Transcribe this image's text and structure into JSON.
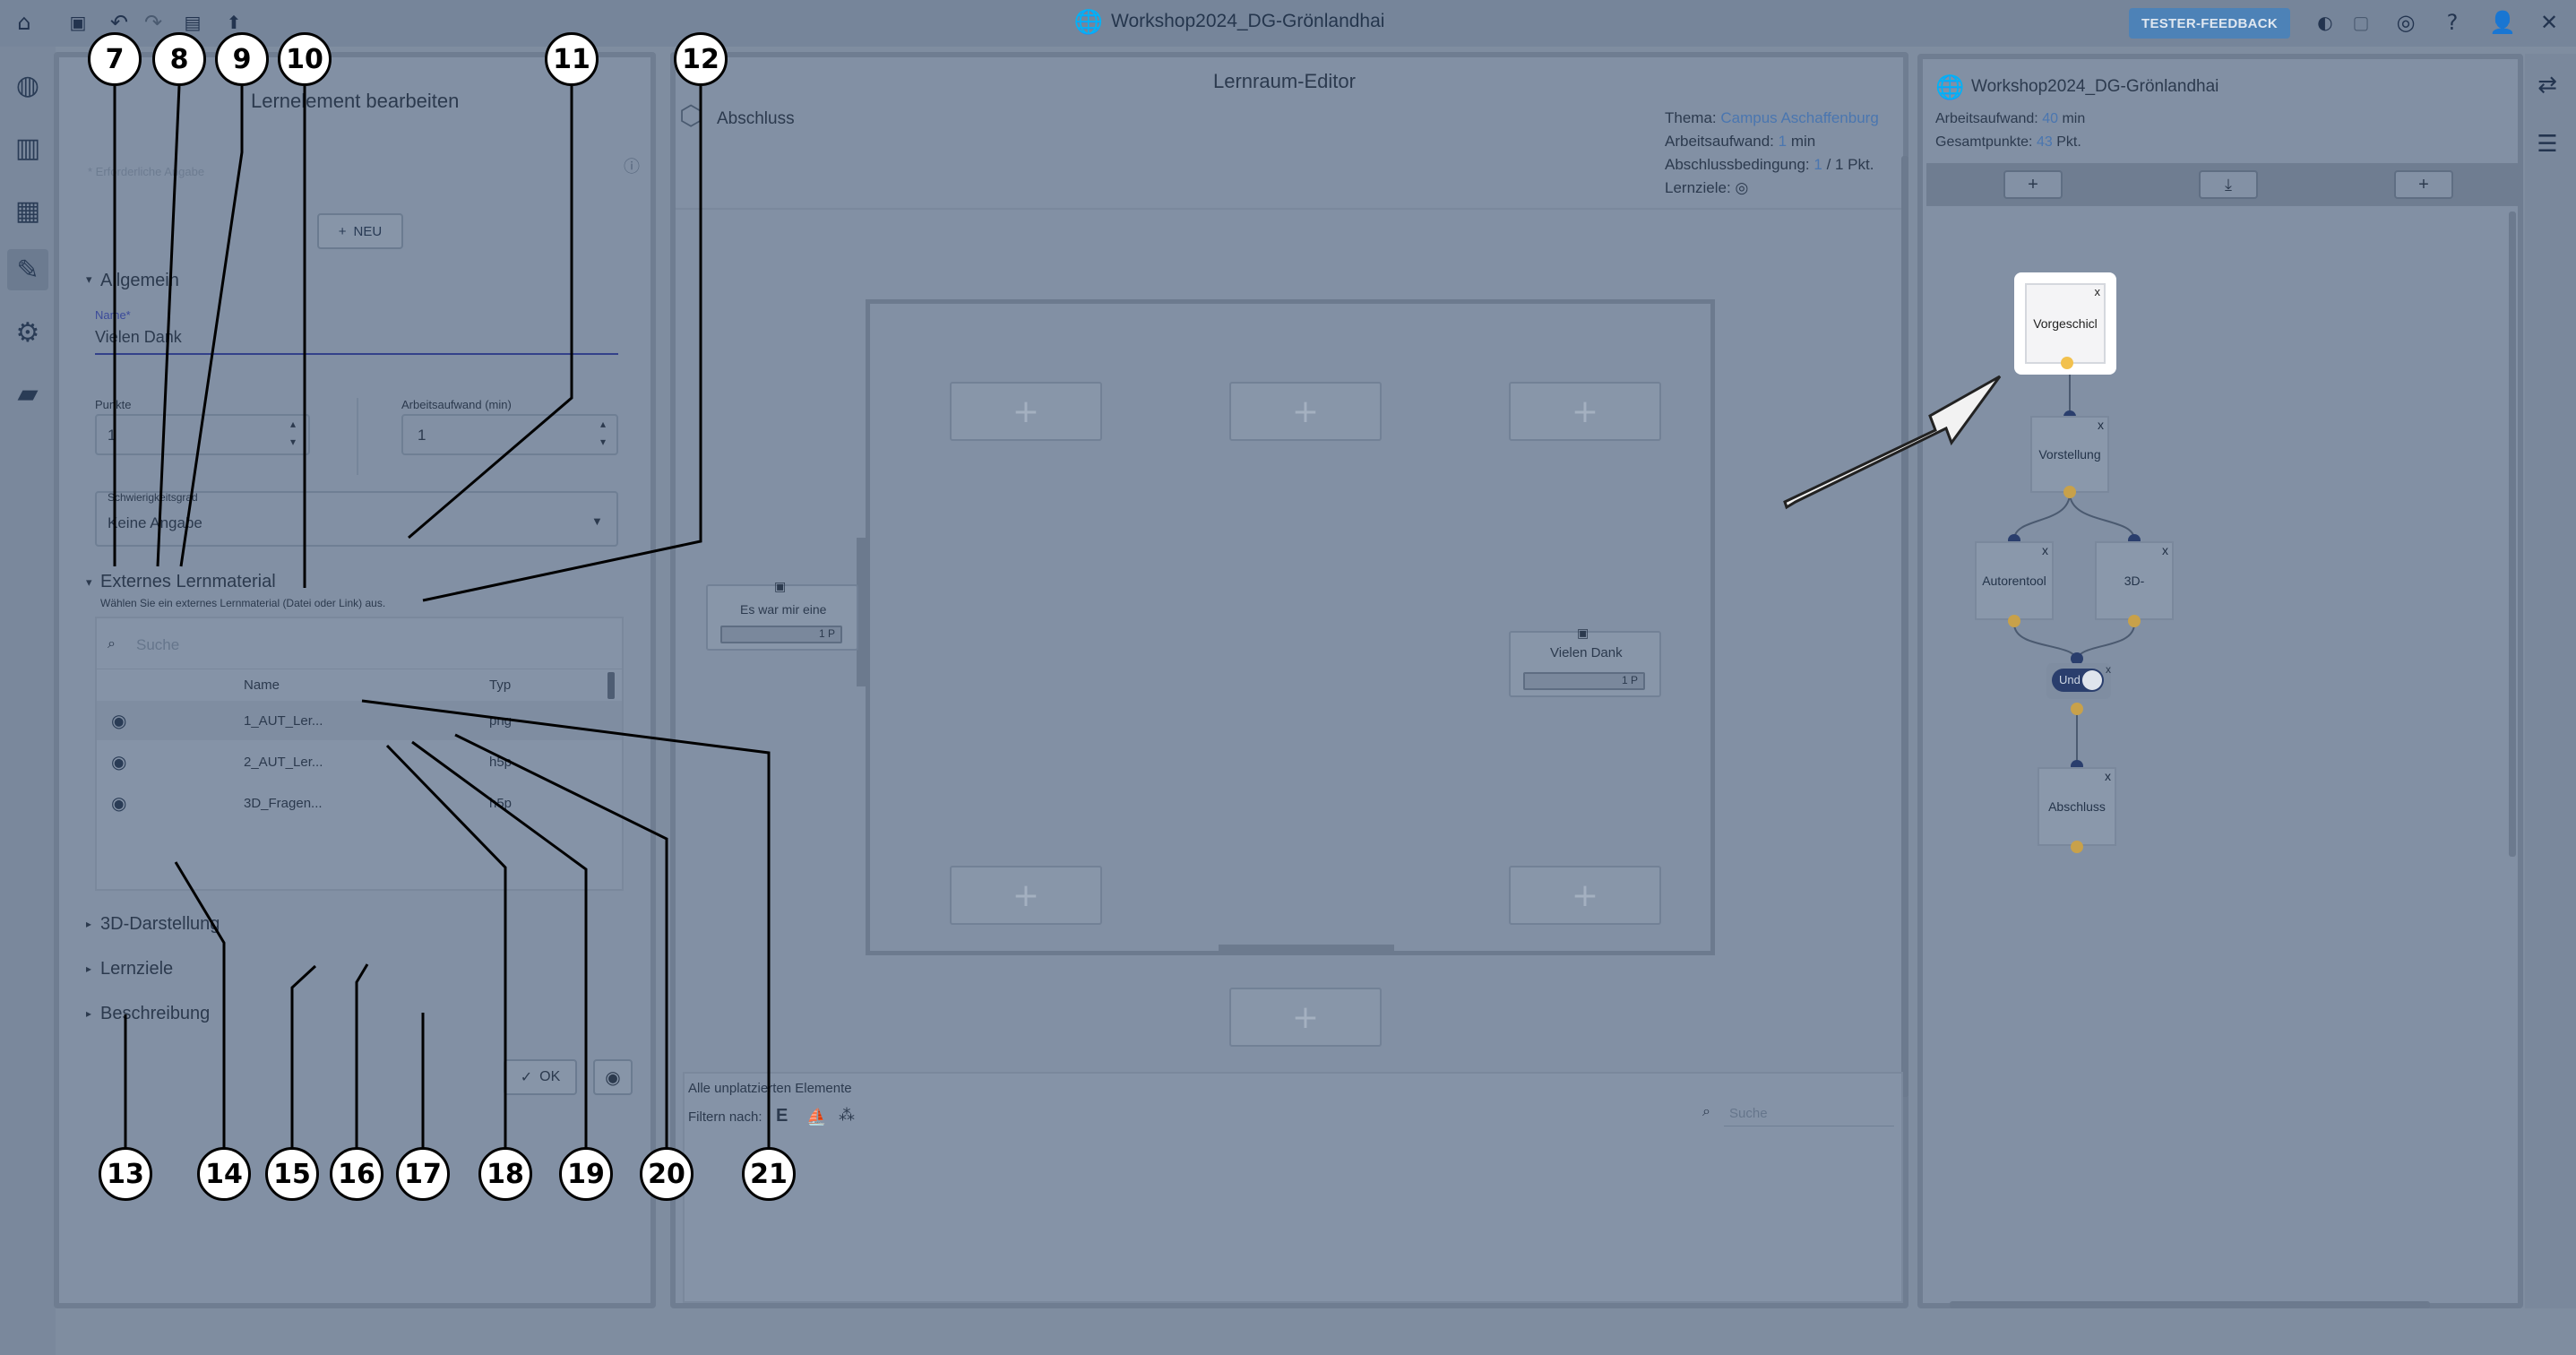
{
  "app": {
    "title": "Workshop2024_DG-Grönlandhai",
    "tester_feedback": "TESTER-FEEDBACK"
  },
  "toolbar_icons": [
    "home-icon",
    "save-icon",
    "undo-icon",
    "redo-icon",
    "import-icon",
    "publish-icon"
  ],
  "header_right_icons": [
    "language-flag-icon",
    "window-icon",
    "target-icon",
    "help-icon",
    "user-icon",
    "close-icon"
  ],
  "left_nav_icons": [
    "world-icon",
    "book-icon",
    "library-icon",
    "editor-icon",
    "settings-icon",
    "folder-icon"
  ],
  "left_panel": {
    "title": "Lernelement bearbeiten",
    "required_hint": "* Erforderliche Angabe",
    "new_button": "NEU",
    "general_section": "Allgemein",
    "name_label": "Name*",
    "name_value": "Vielen Dank",
    "points_label": "Punkte",
    "points_value": "1",
    "workload_label": "Arbeitsaufwand (min)",
    "workload_value": "1",
    "difficulty_label": "Schwierigkeitsgrad",
    "difficulty_value": "Keine Angabe",
    "external_section": "Externes Lernmaterial",
    "external_hint": "Wählen Sie ein externes Lernmaterial (Datei oder Link) aus.",
    "search_placeholder": "Suche",
    "table_headers": [
      "Name",
      "Typ"
    ],
    "table_rows": [
      {
        "name": "1_AUT_Ler...",
        "type": "png"
      },
      {
        "name": "2_AUT_Ler...",
        "type": "h5p"
      },
      {
        "name": "3D_Fragen...",
        "type": "h5p"
      }
    ],
    "section_3d": "3D-Darstellung",
    "section_goals": "Lernziele",
    "section_description": "Beschreibung",
    "ok_button": "OK"
  },
  "editor": {
    "title": "Lernraum-Editor",
    "space_name": "Abschluss",
    "theme_label": "Thema:",
    "theme_value": "Campus Aschaffenburg",
    "workload_label": "Arbeitsaufwand:",
    "workload_value": "1",
    "workload_unit": "min",
    "completion_label": "Abschlussbedingung:",
    "completion_value": "1",
    "completion_total": "/ 1 Pkt.",
    "goals_label": "Lernziele:",
    "element_left_name": "Es war mir eine",
    "element_left_points": "1 P",
    "element_right_name": "Vielen Dank",
    "element_right_points": "1 P",
    "unplaced_title": "Alle unplatzierten Elemente",
    "filter_label": "Filtern nach:",
    "search_placeholder": "Suche"
  },
  "right_panel": {
    "world_name": "Workshop2024_DG-Grönlandhai",
    "workload_label": "Arbeitsaufwand:",
    "workload_value": "40",
    "workload_unit": "min",
    "points_label": "Gesamtpunkte:",
    "points_value": "43",
    "points_unit": "Pkt.",
    "nodes": {
      "vorgeschichte": "Vorgeschicl",
      "vorstellung": "Vorstellung",
      "autorentool": "Autorentool",
      "three_d": "3D-",
      "und": "Und",
      "abschluss": "Abschluss"
    }
  },
  "callouts": [
    "7",
    "8",
    "9",
    "10",
    "11",
    "12",
    "13",
    "14",
    "15",
    "16",
    "17",
    "18",
    "19",
    "20",
    "21"
  ],
  "colors": {
    "accent": "#4d82b7",
    "link": "#4a76b0",
    "overlay_bg": "#7f8da0"
  }
}
